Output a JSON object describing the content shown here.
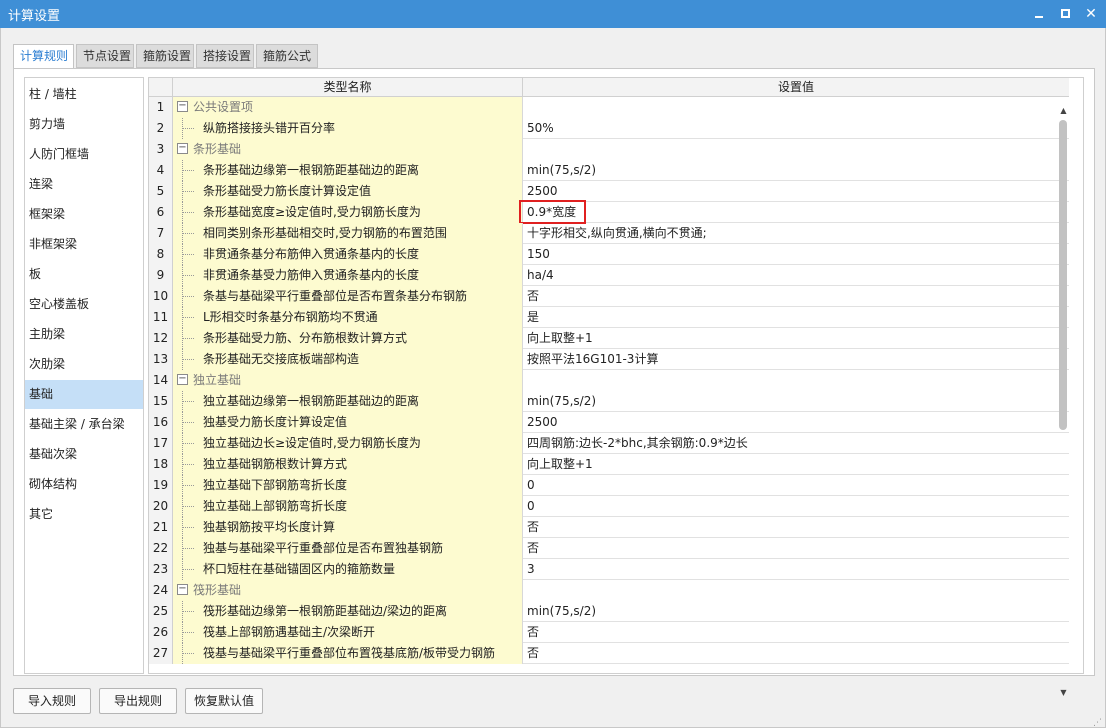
{
  "window": {
    "title": "计算设置",
    "minimize_label": "",
    "close_label": "✕"
  },
  "tabs": [
    "计算规则",
    "节点设置",
    "箍筋设置",
    "搭接设置",
    "箍筋公式"
  ],
  "sidebar": {
    "items": [
      "柱 / 墙柱",
      "剪力墙",
      "人防门框墙",
      "连梁",
      "框架梁",
      "非框架梁",
      "板",
      "空心楼盖板",
      "主肋梁",
      "次肋梁",
      "基础",
      "基础主梁 / 承台梁",
      "基础次梁",
      "砌体结构",
      "其它"
    ],
    "selected": "基础"
  },
  "grid": {
    "col_name": "类型名称",
    "col_value": "设置值",
    "rows": [
      {
        "num": "1",
        "name": "公共设置项",
        "value": "",
        "group": true
      },
      {
        "num": "2",
        "name": "纵筋搭接接头错开百分率",
        "value": "50%"
      },
      {
        "num": "3",
        "name": "条形基础",
        "value": "",
        "group": true
      },
      {
        "num": "4",
        "name": "条形基础边缘第一根钢筋距基础边的距离",
        "value": "min(75,s/2)"
      },
      {
        "num": "5",
        "name": "条形基础受力筋长度计算设定值",
        "value": "2500"
      },
      {
        "num": "6",
        "name": "条形基础宽度≥设定值时,受力钢筋长度为",
        "value": "0.9*宽度"
      },
      {
        "num": "7",
        "name": "相同类别条形基础相交时,受力钢筋的布置范围",
        "value": "十字形相交,纵向贯通,横向不贯通;"
      },
      {
        "num": "8",
        "name": "非贯通条基分布筋伸入贯通条基内的长度",
        "value": "150"
      },
      {
        "num": "9",
        "name": "非贯通条基受力筋伸入贯通条基内的长度",
        "value": "ha/4"
      },
      {
        "num": "10",
        "name": "条基与基础梁平行重叠部位是否布置条基分布钢筋",
        "value": "否"
      },
      {
        "num": "11",
        "name": "L形相交时条基分布钢筋均不贯通",
        "value": "是"
      },
      {
        "num": "12",
        "name": "条形基础受力筋、分布筋根数计算方式",
        "value": "向上取整+1"
      },
      {
        "num": "13",
        "name": "条形基础无交接底板端部构造",
        "value": "按照平法16G101-3计算"
      },
      {
        "num": "14",
        "name": "独立基础",
        "value": "",
        "group": true
      },
      {
        "num": "15",
        "name": "独立基础边缘第一根钢筋距基础边的距离",
        "value": "min(75,s/2)"
      },
      {
        "num": "16",
        "name": "独基受力筋长度计算设定值",
        "value": "2500"
      },
      {
        "num": "17",
        "name": "独立基础边长≥设定值时,受力钢筋长度为",
        "value": "四周钢筋:边长-2*bhc,其余钢筋:0.9*边长"
      },
      {
        "num": "18",
        "name": "独立基础钢筋根数计算方式",
        "value": "向上取整+1"
      },
      {
        "num": "19",
        "name": "独立基础下部钢筋弯折长度",
        "value": "0"
      },
      {
        "num": "20",
        "name": "独立基础上部钢筋弯折长度",
        "value": "0"
      },
      {
        "num": "21",
        "name": "独基钢筋按平均长度计算",
        "value": "否"
      },
      {
        "num": "22",
        "name": "独基与基础梁平行重叠部位是否布置独基钢筋",
        "value": "否"
      },
      {
        "num": "23",
        "name": "杯口短柱在基础锚固区内的箍筋数量",
        "value": "3"
      },
      {
        "num": "24",
        "name": "筏形基础",
        "value": "",
        "group": true
      },
      {
        "num": "25",
        "name": "筏形基础边缘第一根钢筋距基础边/梁边的距离",
        "value": "min(75,s/2)"
      },
      {
        "num": "26",
        "name": "筏基上部钢筋遇基础主/次梁断开",
        "value": "否"
      },
      {
        "num": "27",
        "name": "筏基与基础梁平行重叠部位布置筏基底筋/板带受力钢筋",
        "value": "否"
      }
    ],
    "highlighted_row": "6"
  },
  "buttons": {
    "import": "导入规则",
    "export": "导出规则",
    "restore": "恢复默认值"
  },
  "colors": {
    "titlebar": "#3f8fd6",
    "name_cell_bg": "#fdfbd0",
    "selected_sidebar": "#c5dff7",
    "highlight_border": "#e02020"
  }
}
